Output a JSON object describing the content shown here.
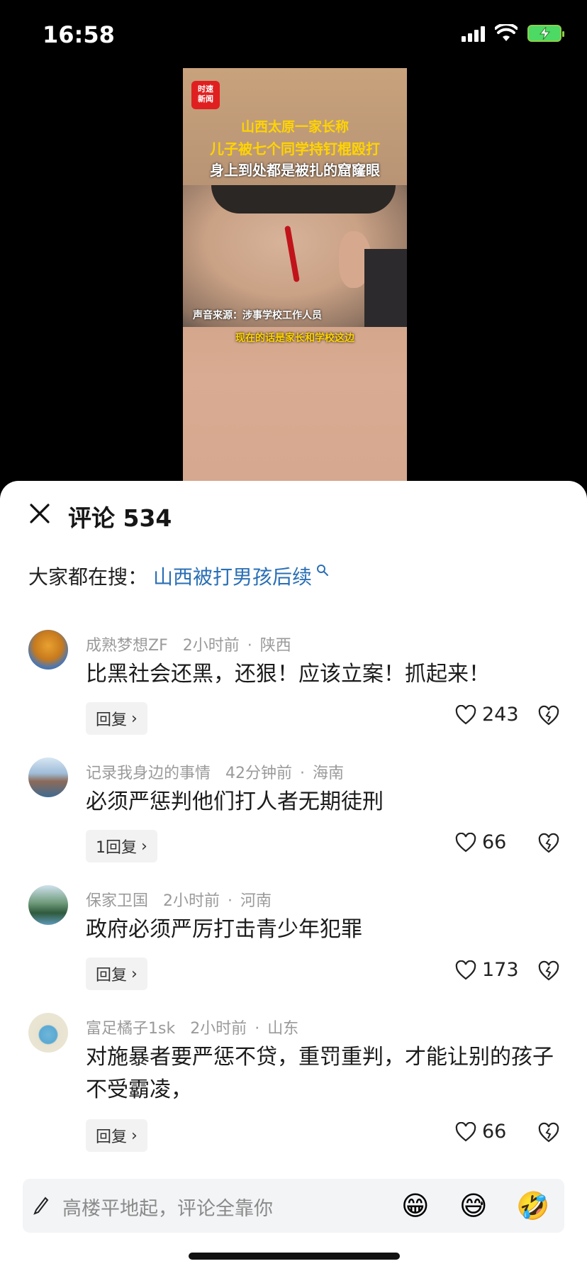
{
  "status_bar": {
    "time": "16:58"
  },
  "video": {
    "logo_text": "时速\n新闻",
    "caption_lines": [
      "山西太原一家长称",
      "儿子被七个同学持钉棍殴打",
      "身上到处都是被扎的窟窿眼"
    ],
    "sound_source": "声音来源：涉事学校工作人员",
    "subtitle": "现在的话是家长和学校这边"
  },
  "comments_panel": {
    "title": "评论 534",
    "search_prefix": "大家都在搜：",
    "search_query": "山西被打男孩后续",
    "items": [
      {
        "user": "成熟梦想ZF",
        "time": "2小时前",
        "location": "陕西",
        "text": "比黑社会还黑，还狠！应该立案！抓起来！",
        "reply_label": "回复",
        "likes": "243"
      },
      {
        "user": "记录我身边的事情",
        "time": "42分钟前",
        "location": "海南",
        "text": "必须严惩判他们打人者无期徒刑",
        "reply_label": "1回复",
        "likes": "66"
      },
      {
        "user": "保家卫国",
        "time": "2小时前",
        "location": "河南",
        "text": "政府必须严厉打击青少年犯罪",
        "reply_label": "回复",
        "likes": "173"
      },
      {
        "user": "富足橘子1sk",
        "time": "2小时前",
        "location": "山东",
        "text": "对施暴者要严惩不贷，重罚重判，才能让别的孩子不受霸凌，",
        "reply_label": "回复",
        "likes": "66"
      }
    ],
    "separator": "·",
    "chevron": "›"
  },
  "input_bar": {
    "placeholder": "高楼平地起，评论全靠你",
    "emojis": [
      "😁",
      "😅",
      "🤣"
    ]
  }
}
